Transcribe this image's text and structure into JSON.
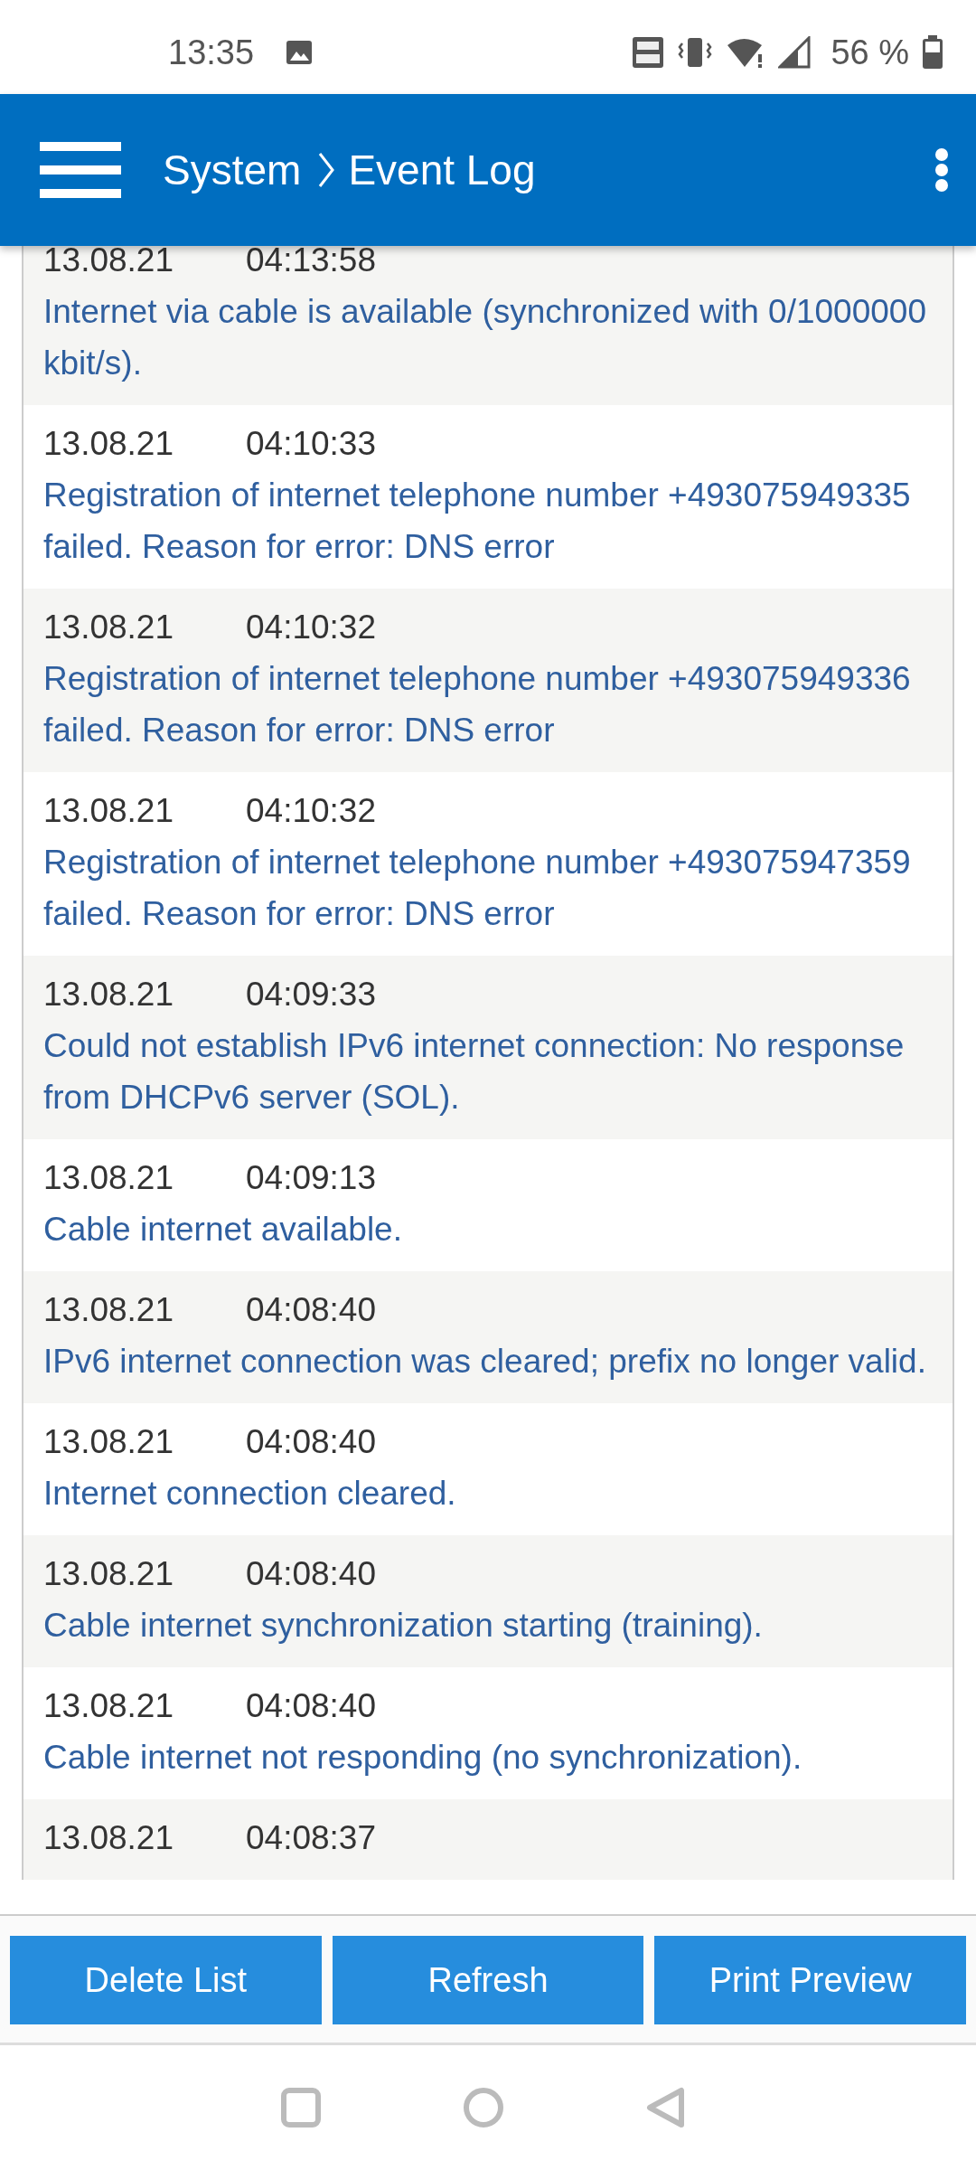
{
  "status_bar": {
    "time": "13:35",
    "battery": "56 %"
  },
  "header": {
    "crumbs": [
      "System",
      "Event Log"
    ]
  },
  "events": [
    {
      "date": "13.08.21",
      "time": "04:13:58",
      "message": "Internet via cable is available (synchronized with 0/1000000 kbit/s)."
    },
    {
      "date": "13.08.21",
      "time": "04:10:33",
      "message": "Registration of internet telephone number +493075949335 failed. Reason for error: DNS error"
    },
    {
      "date": "13.08.21",
      "time": "04:10:32",
      "message": "Registration of internet telephone number +493075949336 failed. Reason for error: DNS error"
    },
    {
      "date": "13.08.21",
      "time": "04:10:32",
      "message": "Registration of internet telephone number +493075947359 failed. Reason for error: DNS error"
    },
    {
      "date": "13.08.21",
      "time": "04:09:33",
      "message": "Could not establish IPv6 internet connection: No response from DHCPv6 server (SOL)."
    },
    {
      "date": "13.08.21",
      "time": "04:09:13",
      "message": "Cable internet available."
    },
    {
      "date": "13.08.21",
      "time": "04:08:40",
      "message": "IPv6 internet connection was cleared; prefix no longer valid."
    },
    {
      "date": "13.08.21",
      "time": "04:08:40",
      "message": "Internet connection cleared."
    },
    {
      "date": "13.08.21",
      "time": "04:08:40",
      "message": "Cable internet synchronization starting (training)."
    },
    {
      "date": "13.08.21",
      "time": "04:08:40",
      "message": "Cable internet not responding (no synchronization)."
    },
    {
      "date": "13.08.21",
      "time": "04:08:37"
    }
  ],
  "buttons": [
    "Delete List",
    "Refresh",
    "Print Preview"
  ]
}
